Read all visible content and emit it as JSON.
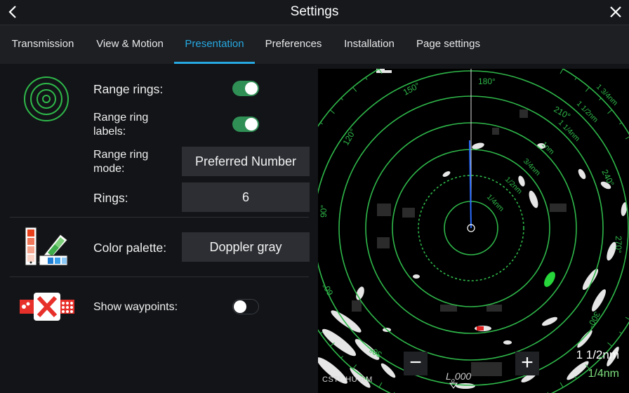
{
  "header": {
    "title": "Settings"
  },
  "tabs": [
    {
      "label": "Transmission"
    },
    {
      "label": "View & Motion"
    },
    {
      "label": "Presentation"
    },
    {
      "label": "Preferences"
    },
    {
      "label": "Installation"
    },
    {
      "label": "Page settings"
    }
  ],
  "settings": {
    "range_rings": {
      "label": "Range rings:",
      "on": true
    },
    "range_ring_labels": {
      "label": "Range ring labels:",
      "on": true
    },
    "range_ring_mode": {
      "label": "Range ring mode:",
      "value": "Preferred Number"
    },
    "rings": {
      "label": "Rings:",
      "value": "6"
    },
    "color_palette": {
      "label": "Color palette:",
      "value": "Doppler gray"
    },
    "show_waypoints": {
      "label": "Show waypoints:",
      "on": false
    }
  },
  "radar": {
    "bearings": [
      "150°",
      "180°",
      "210°",
      "120°",
      "240°",
      "90°",
      "270°",
      "60°",
      "300°",
      "30°"
    ],
    "ring_labels": [
      "1 3/4nm",
      "1 1/2nm",
      "1 1/4nm",
      "1nm",
      "3/4nm",
      "1/2nm",
      "1/4nm"
    ],
    "range": "1 1/2nm",
    "ring_interval": "1/4nm",
    "mode": "CSTL HU RM",
    "heading_readout": "000",
    "zoom_out_label": "−",
    "zoom_in_label": "+"
  },
  "colors": {
    "accent": "#27a8e0",
    "toggle_on": "#2f8f55",
    "ring_green": "#2fb84a",
    "heading_line": "#2a6cff"
  }
}
